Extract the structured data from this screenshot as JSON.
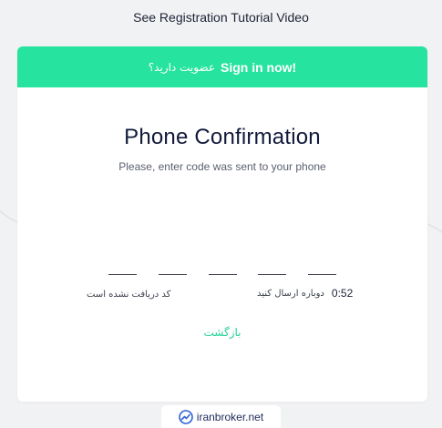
{
  "top_link": "See Registration Tutorial Video",
  "banner": {
    "persian_text": "عضویت دارید؟",
    "signin_label": "Sign in now!"
  },
  "confirm": {
    "title": "Phone Confirmation",
    "subtitle": "Please, enter code was sent to your phone",
    "otp_slots": [
      "",
      "",
      "",
      "",
      ""
    ],
    "no_code_text": "کد دریافت نشده است",
    "resend_text": "دوباره ارسال کنید",
    "timer": "0:52",
    "back_text": "بازگشت"
  },
  "brand": {
    "text": "iranbroker.net",
    "icon": "trend-chart-icon"
  },
  "colors": {
    "accent": "#26e39f",
    "title": "#121a3a"
  }
}
